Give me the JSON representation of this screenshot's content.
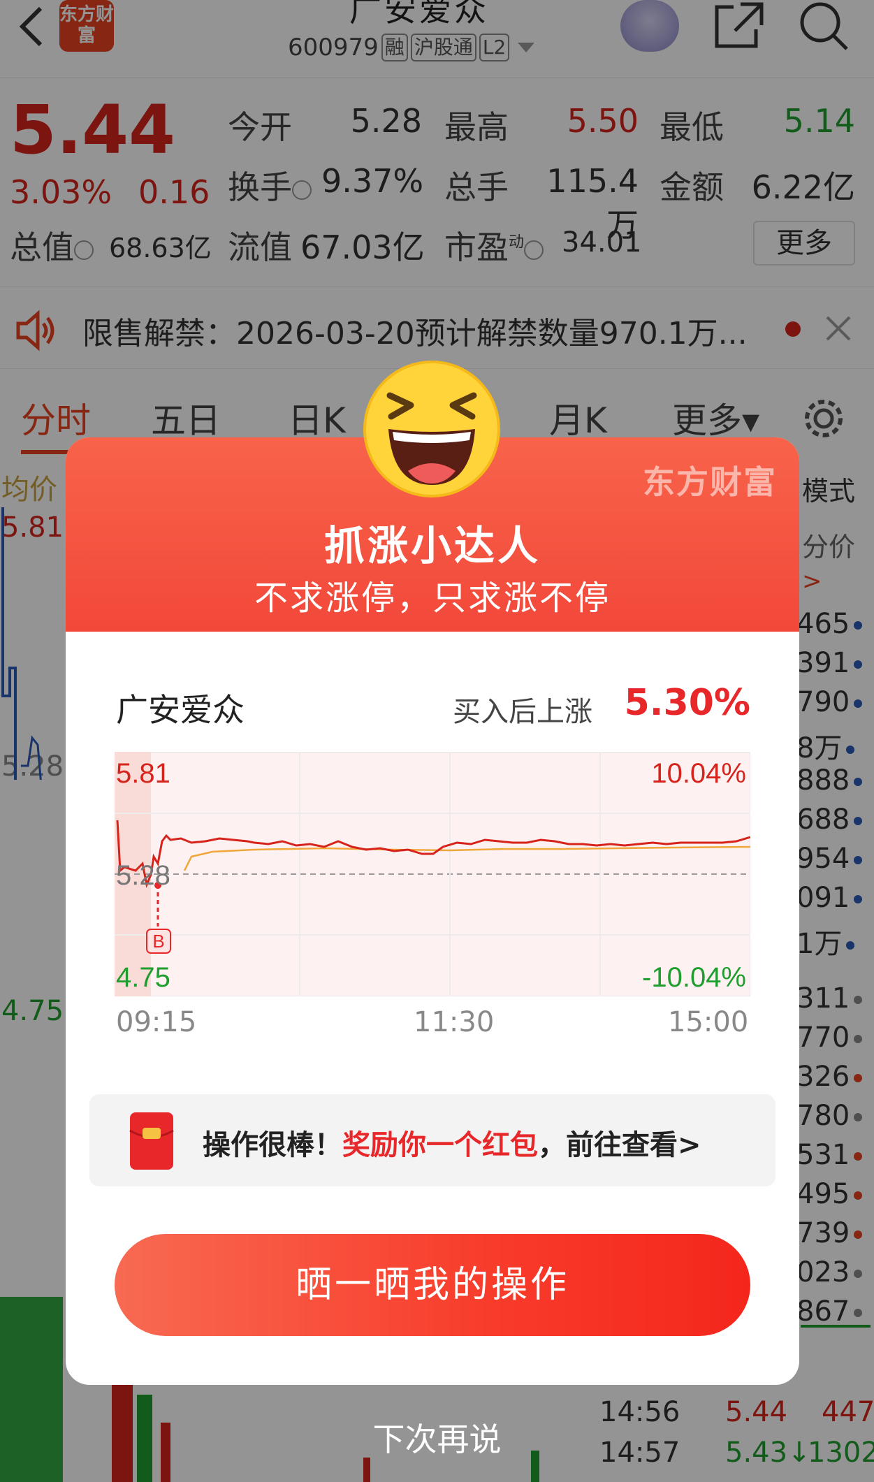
{
  "header": {
    "logo_text": "东方财富",
    "stock_name": "广安爱众",
    "stock_code": "600979",
    "tags": [
      "融",
      "沪股通",
      "L2"
    ]
  },
  "quote": {
    "price": "5.44",
    "change_pct": "3.03%",
    "change": "0.16",
    "open_label": "今开",
    "open": "5.28",
    "high_label": "最高",
    "high": "5.50",
    "low_label": "最低",
    "low": "5.14",
    "turnover_label": "换手",
    "turnover": "9.37%",
    "volume_label": "总手",
    "volume": "115.4万",
    "amount_label": "金额",
    "amount": "6.22亿",
    "mktcap_label": "总值",
    "mktcap": "68.63亿",
    "float_label": "流值",
    "float": "67.03亿",
    "pe_label": "市盈",
    "pe_sup": "动",
    "pe": "34.01",
    "more": "更多"
  },
  "notice": {
    "text": "限售解禁：2026-03-20预计解禁数量970.1万..."
  },
  "tabs": [
    "分时",
    "五日",
    "日K",
    "月K",
    "更多▾"
  ],
  "background": {
    "avg_label": "均价",
    "high_label": "5.81",
    "mid_label": "5.28",
    "low_label": "4.75",
    "mode_label": "模式",
    "fen_label": "分价",
    "right_values": [
      "465",
      "391",
      "790",
      "8万",
      "888",
      "688",
      "954",
      "091",
      "1万",
      "311",
      "770",
      "326",
      "780",
      "531",
      "495",
      "739",
      "023",
      "867"
    ],
    "trades": [
      {
        "time": "14:56",
        "price": "5.44",
        "vol": "447"
      },
      {
        "time": "14:57",
        "price": "5.43↓",
        "vol": "1302"
      }
    ]
  },
  "modal": {
    "brand": "东方财富",
    "title": "抓涨小达人",
    "subtitle": "不求涨停，只求涨不停",
    "stock_name": "广安爱众",
    "rise_label": "买入后上涨",
    "rise_value": "5.30%",
    "chart_labels": {
      "price_high": "5.81",
      "price_mid": "5.28",
      "price_low": "4.75",
      "pct_high": "10.04%",
      "pct_low": "-10.04%",
      "buy_marker": "B"
    },
    "time_axis": [
      "09:15",
      "11:30",
      "15:00"
    ],
    "bonus_prefix": "操作很棒！",
    "bonus_highlight": "奖励你一个红包",
    "bonus_suffix": "，前往查看>",
    "share_button": "晒一晒我的操作",
    "later": "下次再说"
  },
  "colors": {
    "up": "#d6241c",
    "down": "#1f9e2f",
    "accent": "#e8421f"
  }
}
